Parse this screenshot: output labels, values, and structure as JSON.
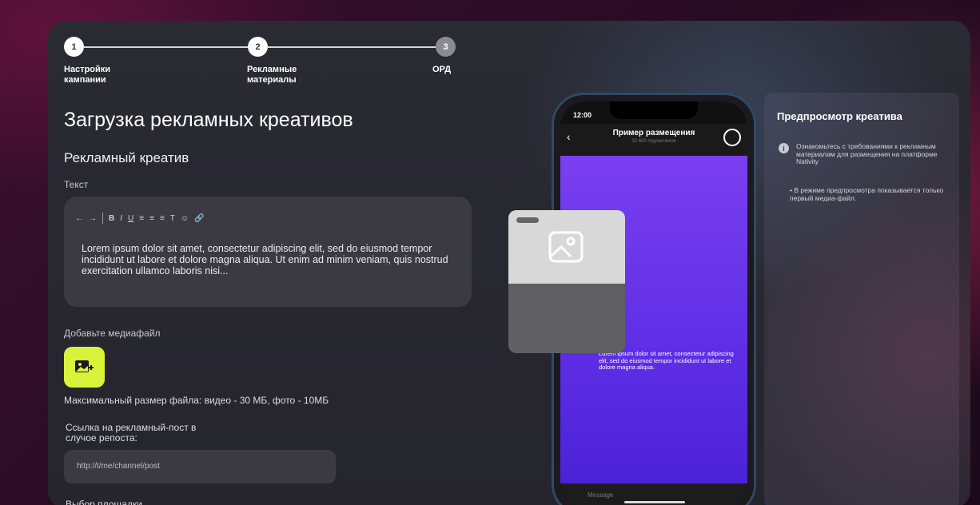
{
  "stepper": {
    "steps": [
      {
        "number": "1",
        "label": "Настройки кампании"
      },
      {
        "number": "2",
        "label": "Рекламные материалы"
      },
      {
        "number": "3",
        "label": "ОРД"
      }
    ]
  },
  "main": {
    "title": "Загрузка рекламных креативов",
    "section_title": "Рекламный креатив",
    "text_label": "Текст",
    "editor_text": "Lorem ipsum dolor sit amet, consectetur adipiscing elit, sed do eiusmod tempor incididunt ut labore et dolore magna aliqua. Ut enim ad minim veniam, quis nostrud exercitation ullamco laboris nisi...",
    "toolbar": [
      "←",
      "→",
      "B",
      "I",
      "U",
      "≡",
      "≡",
      "≡",
      "T",
      "☺",
      "🔗"
    ],
    "media_label": "Добавьте медиафайл",
    "media_limits": "Максимальный размер файла: видео - 30 МБ, фото - 10МБ",
    "repost_label": "Ссылка на рекламный-пост в случое репоста:",
    "repost_placeholder": "http://t/me/channel/post",
    "cut_label": "Выбор площадки"
  },
  "phone": {
    "time": "12:00",
    "chat_title": "Пример размещения",
    "chat_subtitle": "32 600 подписчиков",
    "message_text": "Lorem ipsum dolor sit amet, consectetur adipiscing elit, sed do eiusmod tempor incididunt ut labore et dolore magna aliqua.",
    "input_placeholder": "Message",
    "content_color": "#6a35ec"
  },
  "preview": {
    "title": "Предпросмотр креатива",
    "info": "Ознакомьтесь с требованиями к рекламным материалам для размещения на платформе Nativity",
    "note": "• В режиме предпросмотра показывается только первый медиа-файл."
  },
  "colors": {
    "accent_media_button": "#d9f23a",
    "phone_bg": "#5e2ee6"
  }
}
